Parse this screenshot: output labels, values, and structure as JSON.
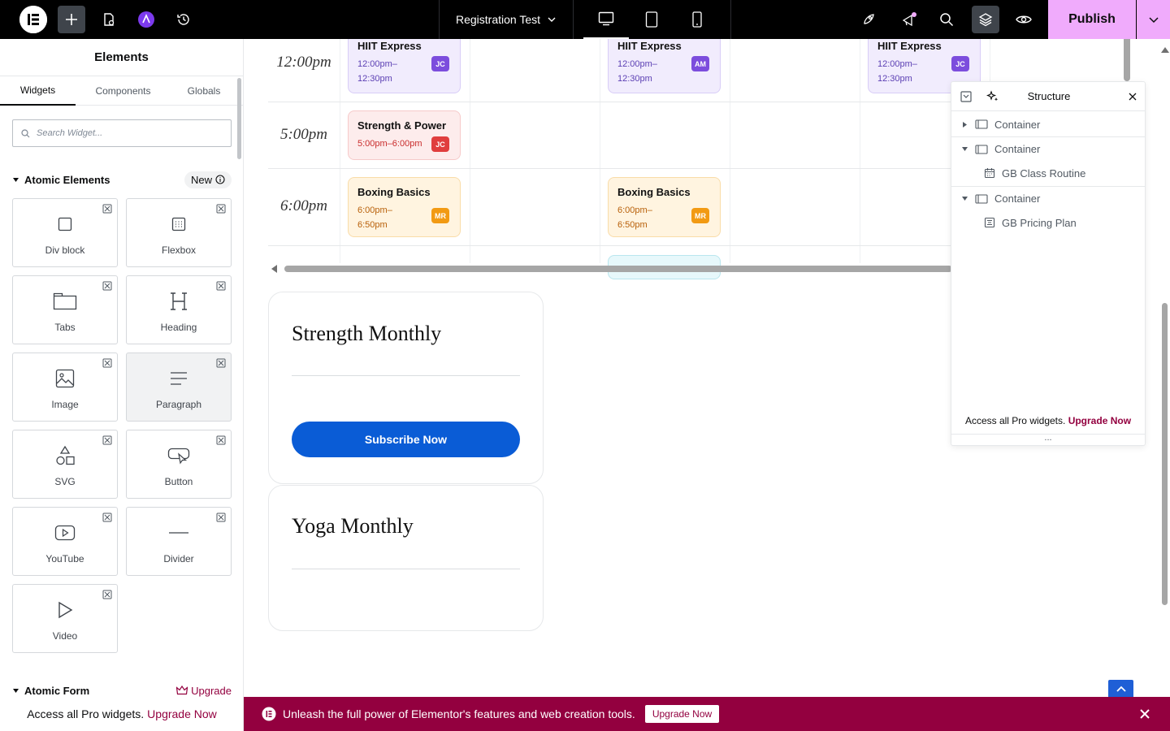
{
  "topbar": {
    "document_title": "Registration Test",
    "publish_label": "Publish"
  },
  "panel": {
    "title": "Elements",
    "tabs": [
      "Widgets",
      "Components",
      "Globals"
    ],
    "search_placeholder": "Search Widget...",
    "category": "Atomic Elements",
    "new_badge": "New",
    "widgets": [
      "Div block",
      "Flexbox",
      "Tabs",
      "Heading",
      "Image",
      "Paragraph",
      "SVG",
      "Button",
      "YouTube",
      "Divider",
      "Video"
    ],
    "next_category": "Atomic Form",
    "upgrade_label": "Upgrade",
    "footer_text": "Access all Pro widgets.",
    "footer_link": "Upgrade Now"
  },
  "schedule": {
    "times": [
      "12:00pm",
      "5:00pm",
      "6:00pm"
    ],
    "events": [
      {
        "title": "HIIT Express",
        "time_line1": "12:00pm–",
        "time_line2": "12:30pm",
        "badge": "JC"
      },
      {
        "title": "HIIT Express",
        "time_line1": "12:00pm–",
        "time_line2": "12:30pm",
        "badge": "AM"
      },
      {
        "title": "HIIT Express",
        "time_line1": "12:00pm–",
        "time_line2": "12:30pm",
        "badge": "JC"
      },
      {
        "title": "Strength & Power",
        "time_line1": "5:00pm–6:00pm",
        "time_line2": "",
        "badge": "JC"
      },
      {
        "title": "Boxing Basics",
        "time_line1": "6:00pm–",
        "time_line2": "6:50pm",
        "badge": "MR"
      },
      {
        "title": "Boxing Basics",
        "time_line1": "6:00pm–",
        "time_line2": "6:50pm",
        "badge": "MR"
      }
    ]
  },
  "pricing": {
    "card1_title": "Strength Monthly",
    "card1_button": "Subscribe Now",
    "card2_title": "Yoga Monthly"
  },
  "structure": {
    "title": "Structure",
    "items": [
      "Container",
      "Container",
      "GB Class Routine",
      "Container",
      "GB Pricing Plan"
    ],
    "footer_text": "Access all Pro widgets.",
    "footer_link": "Upgrade Now",
    "dots": "..."
  },
  "banner": {
    "text": "Unleash the full power of Elementor's features and web creation tools.",
    "button": "Upgrade Now"
  },
  "colors": {
    "accent_pink": "#f0abfc",
    "brand_maroon": "#93003f",
    "button_blue": "#0a5cd6"
  }
}
